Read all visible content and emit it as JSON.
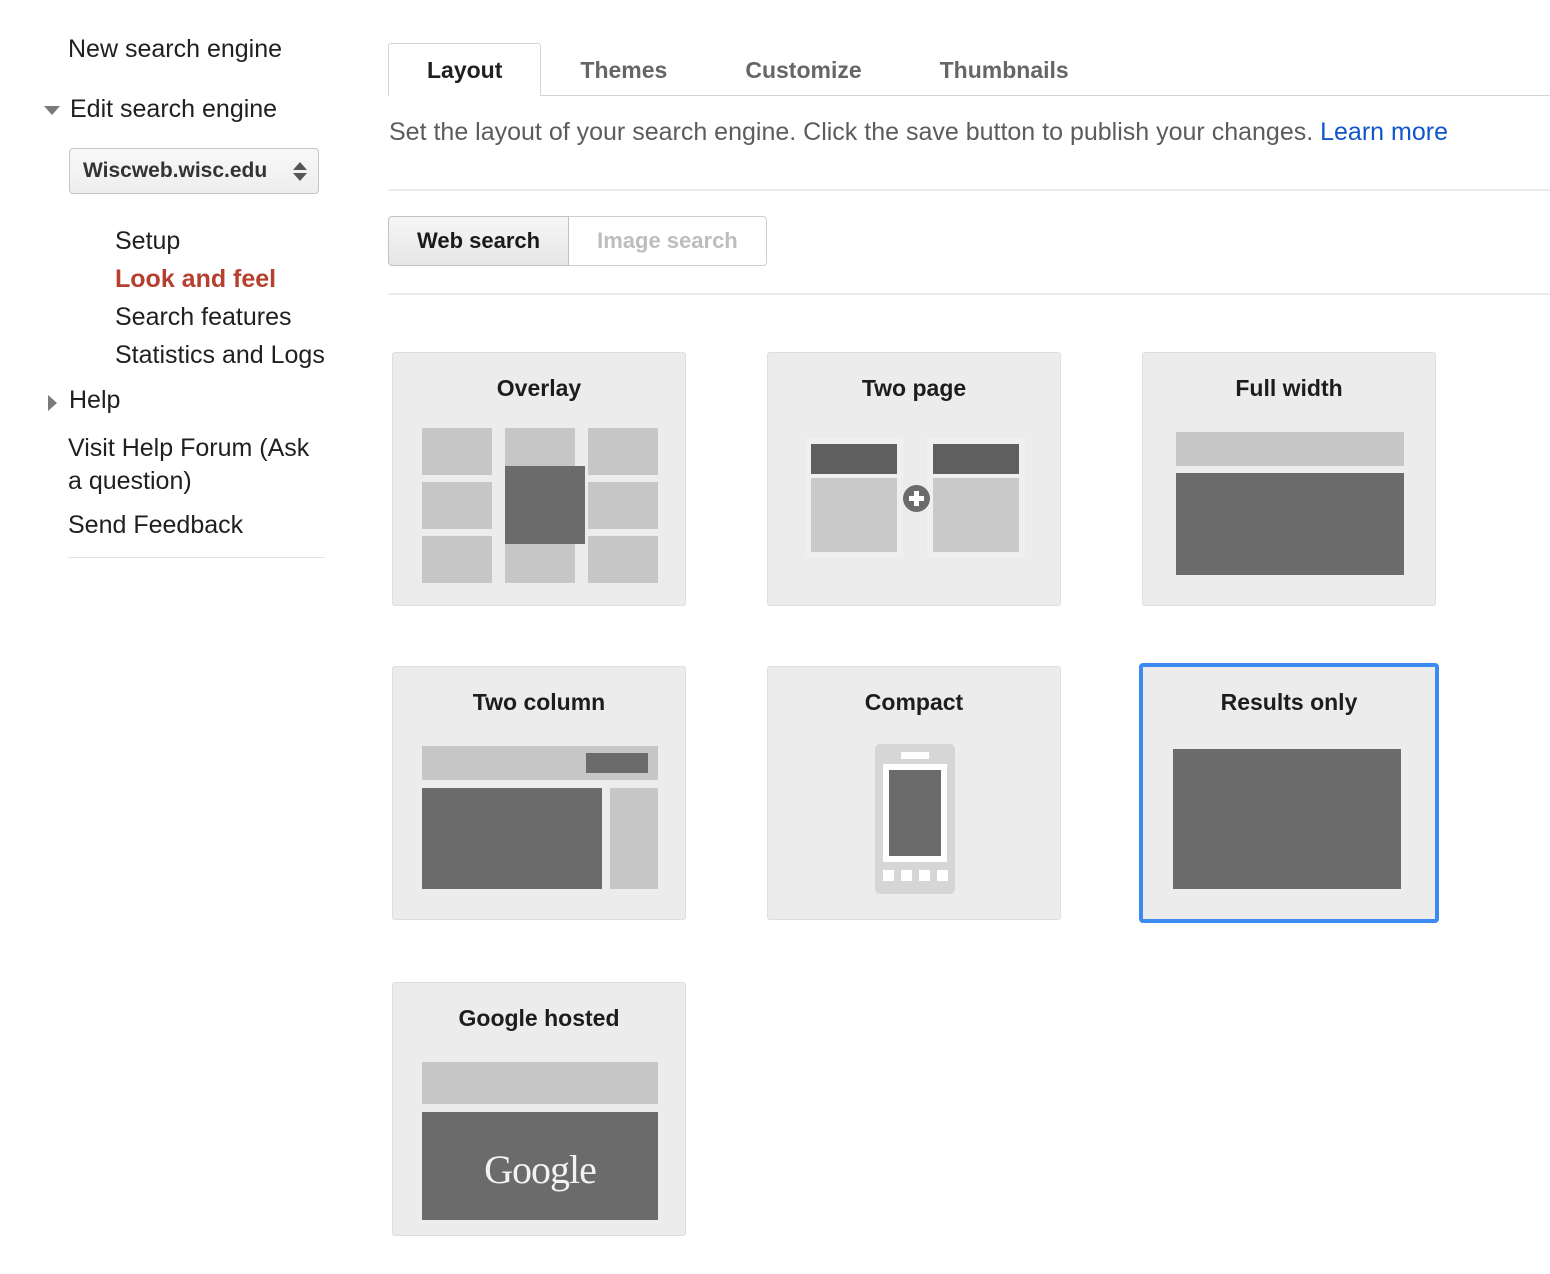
{
  "sidebar": {
    "new_search_engine": "New search engine",
    "edit_search_engine": "Edit search engine",
    "engine_select_value": "Wiscweb.wisc.edu",
    "sub_items": [
      {
        "label": "Setup",
        "active": false
      },
      {
        "label": "Look and feel",
        "active": true
      },
      {
        "label": "Search features",
        "active": false
      },
      {
        "label": "Statistics and Logs",
        "active": false
      }
    ],
    "help": "Help",
    "visit_help_forum": "Visit Help Forum (Ask a question)",
    "send_feedback": "Send Feedback"
  },
  "main": {
    "tabs": [
      {
        "label": "Layout",
        "active": true
      },
      {
        "label": "Themes",
        "active": false
      },
      {
        "label": "Customize",
        "active": false
      },
      {
        "label": "Thumbnails",
        "active": false
      }
    ],
    "description": "Set the layout of your search engine. Click the save button to publish your changes.",
    "learn_more": "Learn more",
    "search_types": [
      {
        "label": "Web search",
        "selected": true
      },
      {
        "label": "Image search",
        "selected": false
      }
    ],
    "layouts": [
      {
        "title": "Overlay",
        "selected": false
      },
      {
        "title": "Two page",
        "selected": false
      },
      {
        "title": "Full width",
        "selected": false
      },
      {
        "title": "Two column",
        "selected": false
      },
      {
        "title": "Compact",
        "selected": false
      },
      {
        "title": "Results only",
        "selected": true
      },
      {
        "title": "Google hosted",
        "selected": false
      }
    ],
    "google_wordmark": "Google"
  },
  "colors": {
    "accent_selected": "#3b8bf0",
    "active_nav": "#b5402f",
    "link": "#1155cc",
    "card_bg": "#ececec",
    "block_dark": "#6b6b6b",
    "block_light": "#c6c6c6"
  }
}
